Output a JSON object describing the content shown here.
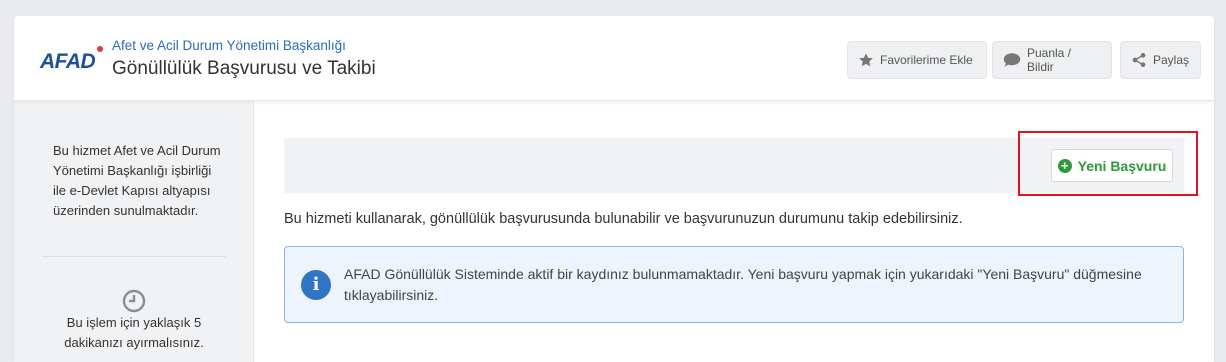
{
  "header": {
    "logo_text": "AFAD",
    "org_name": "Afet ve Acil Durum Yönetimi Başkanlığı",
    "service_title": "Gönüllülük Başvurusu ve Takibi",
    "buttons": {
      "favorites": {
        "label": "Favorilerime Ekle",
        "icon": "star-icon"
      },
      "rate": {
        "label": "Puanla / Bildir",
        "icon": "speech-bubble-icon"
      },
      "share": {
        "label": "Paylaş",
        "icon": "share-icon"
      }
    }
  },
  "sidebar": {
    "info_text": "Bu hizmet Afet ve Acil Durum Yönetimi Başkanlığı işbirliği ile e-Devlet Kapısı altyapısı üzerinden sunulmaktadır.",
    "duration_icon": "clock-icon",
    "duration_text": "Bu işlem için yaklaşık 5 dakikanızı ayırmalısınız."
  },
  "main": {
    "new_application_label": "Yeni Başvuru",
    "description": "Bu hizmeti kullanarak, gönüllülük başvurusunda bulunabilir ve başvurunuzun durumunu takip edebilirsiniz.",
    "alert_icon": "info-icon",
    "alert_text": "AFAD Gönüllülük Sisteminde aktif bir kaydınız bulunmamaktadır. Yeni başvuru yapmak için yukarıdaki \"Yeni Başvuru\" düğmesine tıklayabilirsiniz."
  },
  "colors": {
    "brand_blue": "#1d4f9c",
    "link_blue": "#2a6cbf",
    "success_green": "#2e9a3c",
    "highlight_red": "#e0141e",
    "info_blue": "#2f74c5"
  }
}
